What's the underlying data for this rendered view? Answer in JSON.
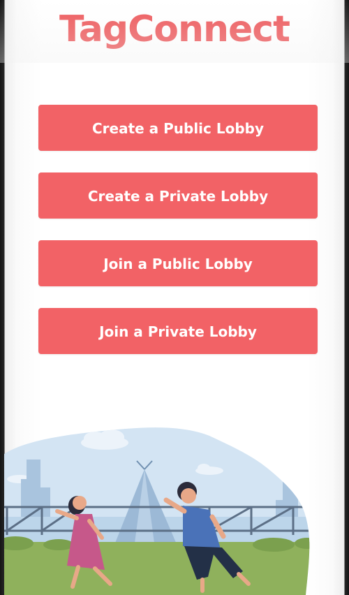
{
  "app": {
    "title": "TagConnect"
  },
  "menu": {
    "create_public_label": "Create a Public Lobby",
    "create_private_label": "Create a Private Lobby",
    "join_public_label": "Join a Public Lobby",
    "join_private_label": "Join a Private Lobby"
  },
  "colors": {
    "accent": "#EE5A5D",
    "button_bg": "#F26266",
    "button_text": "#FFFFFF",
    "sky": "#D3E4F3",
    "grass": "#8FB15C"
  },
  "illustration": {
    "name": "kids-playing-illustration",
    "elements": [
      "cloud",
      "tent",
      "fence",
      "girl-running",
      "boy-running",
      "bushes"
    ]
  }
}
